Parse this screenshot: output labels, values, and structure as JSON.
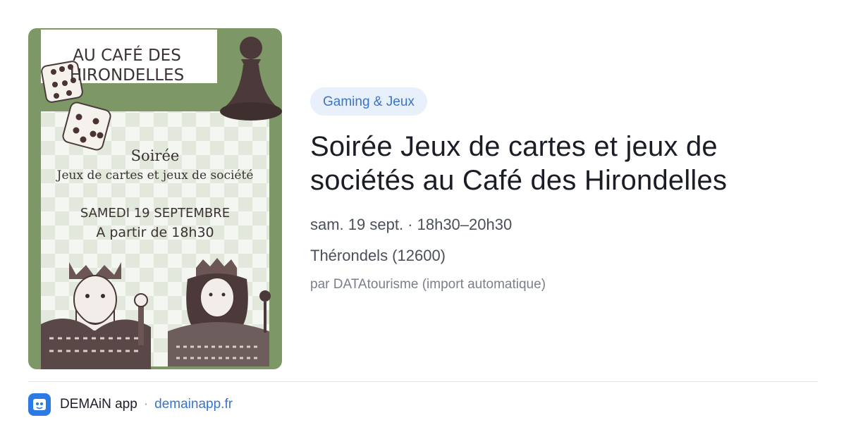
{
  "poster": {
    "heading_line1": "AU CAFÉ DES",
    "heading_line2": "HIRONDELLES",
    "soiree": "Soirée",
    "subtitle": "Jeux de cartes et jeux de société",
    "date_line": "SAMEDI 19 SEPTEMBRE",
    "time_line": "A partir de 18h30",
    "frame_color": "#7d9766"
  },
  "category_badge": "Gaming & Jeux",
  "event": {
    "title_line1": "Soirée Jeux de cartes et jeux de",
    "title_line2": "sociétés au Café des Hirondelles",
    "datetime": "sam. 19 sept. · 18h30–20h30",
    "location": "Thérondels (12600)",
    "source": "par DATAtourisme (import automatique)"
  },
  "footer": {
    "app_icon": "demain-app-icon",
    "app_name": "DEMAiN app",
    "separator": "·",
    "domain": "demainapp.fr"
  },
  "colors": {
    "accent": "#3a74c9",
    "badge_bg": "#e8f0fb",
    "app_icon_bg": "#2c7be5"
  }
}
